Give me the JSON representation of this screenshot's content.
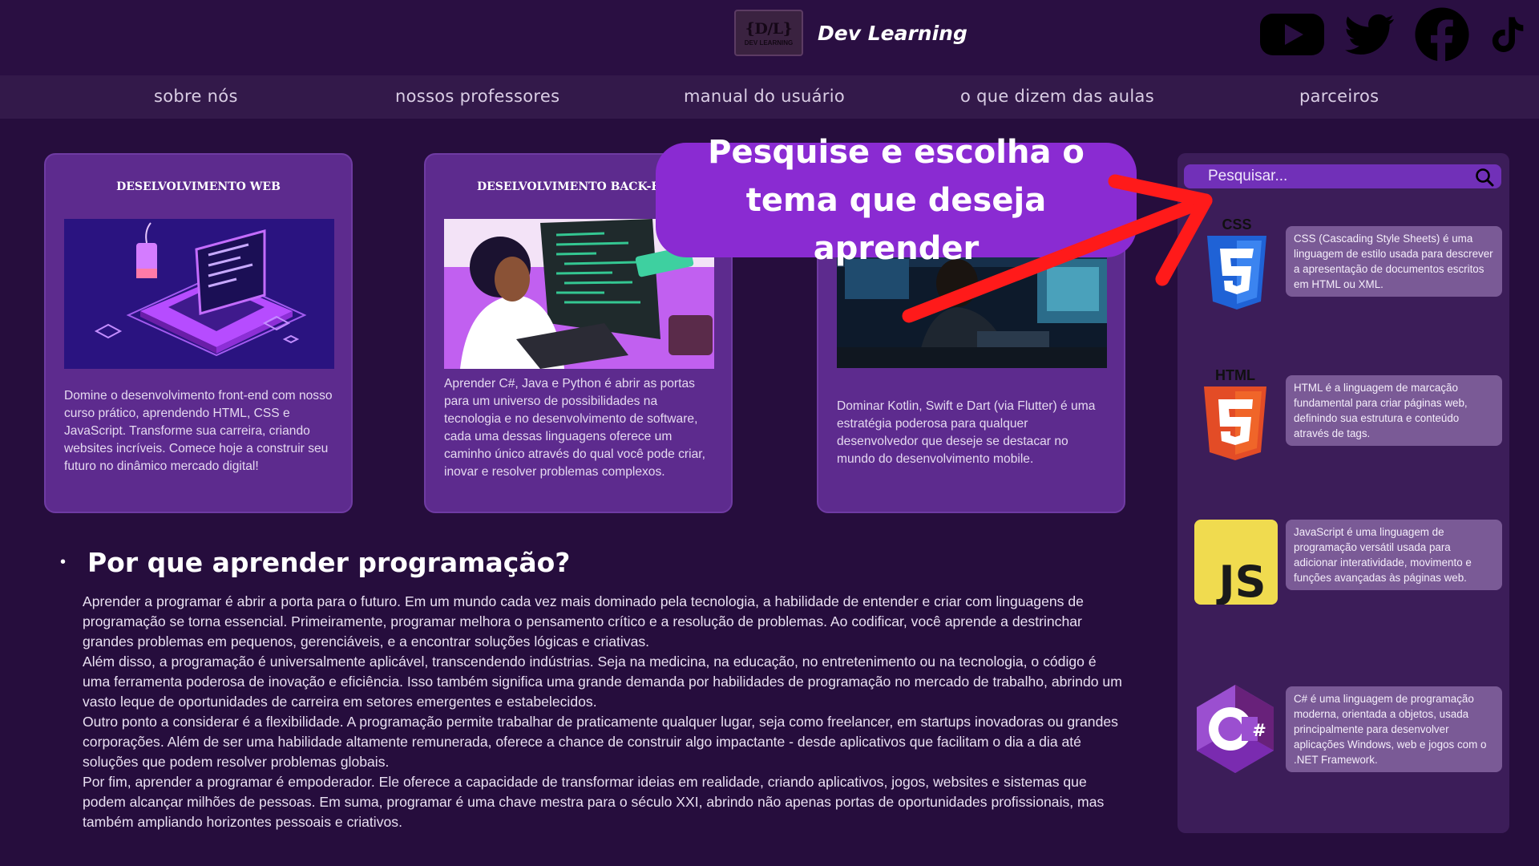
{
  "header": {
    "logo_text": "{D/L}",
    "logo_subtext": "DEV LEARNING",
    "brand_name": "Dev Learning",
    "socials": [
      "youtube-icon",
      "twitter-icon",
      "facebook-icon",
      "tiktok-icon"
    ]
  },
  "nav": {
    "items": [
      {
        "label": "sobre nós"
      },
      {
        "label": "nossos professores"
      },
      {
        "label": "manual do usuário"
      },
      {
        "label": "o que dizem das aulas"
      },
      {
        "label": "parceiros"
      }
    ]
  },
  "cards": [
    {
      "title": "DESELVOLVIMENTO WEB",
      "text": "Domine o desenvolvimento front-end com nosso curso prático, aprendendo HTML, CSS e JavaScript. Transforme sua carreira, criando websites incríveis. Comece hoje a construir seu futuro no dinâmico mercado digital!"
    },
    {
      "title": "DESELVOLVIMENTO BACK-END",
      "text": "Aprender C#, Java e Python é abrir as portas para um universo de possibilidades na tecnologia e no desenvolvimento de software, cada uma dessas linguagens oferece um caminho único através do qual você pode criar, inovar e resolver problemas complexos."
    },
    {
      "title": "",
      "text": "Dominar Kotlin, Swift e Dart (via Flutter) é uma estratégia poderosa para qualquer desenvolvedor que deseje se destacar no mundo do desenvolvimento mobile."
    }
  ],
  "article": {
    "heading": "Por que aprender programação?",
    "paragraphs": [
      "Aprender a programar é abrir a porta para o futuro. Em um mundo cada vez mais dominado pela tecnologia, a habilidade de entender e criar com linguagens de programação se torna essencial. Primeiramente, programar melhora o pensamento crítico e a resolução de problemas. Ao codificar, você aprende a destrinchar grandes problemas em pequenos, gerenciáveis, e a encontrar soluções lógicas e criativas.",
      "Além disso, a programação é universalmente aplicável, transcendendo indústrias. Seja na medicina, na educação, no entretenimento ou na tecnologia, o código é uma ferramenta poderosa de inovação e eficiência. Isso também significa uma grande demanda por habilidades de programação no mercado de trabalho, abrindo um vasto leque de oportunidades de carreira em setores emergentes e estabelecidos.",
      "Outro ponto a considerar é a flexibilidade. A programação permite trabalhar de praticamente qualquer lugar, seja como freelancer, em startups inovadoras ou grandes corporações. Além de ser uma habilidade altamente remunerada, oferece a chance de construir algo impactante - desde aplicativos que facilitam o dia a dia até soluções que podem resolver problemas globais.",
      "Por fim, aprender a programar é empoderador. Ele oferece a capacidade de transformar ideias em realidade, criando aplicativos, jogos, websites e sistemas que podem alcançar milhões de pessoas. Em suma, programar é uma chave mestra para o século XXI, abrindo não apenas portas de oportunidades profissionais, mas também ampliando horizontes pessoais e criativos."
    ]
  },
  "sidebar": {
    "search_placeholder": "Pesquisar...",
    "techs": [
      {
        "icon": "css3-icon",
        "label": "CSS",
        "text": "CSS (Cascading Style Sheets) é uma linguagem de estilo usada para descrever a apresentação de documentos escritos em HTML ou XML."
      },
      {
        "icon": "html5-icon",
        "label": "HTML",
        "text": "HTML é a linguagem de marcação fundamental para criar páginas web, definindo sua estrutura e conteúdo através de tags."
      },
      {
        "icon": "javascript-icon",
        "label": "JS",
        "text": "JavaScript é uma linguagem de programação versátil usada para adicionar interatividade, movimento e funções avançadas às páginas web."
      },
      {
        "icon": "csharp-icon",
        "label": "C#",
        "text": "C# é uma linguagem de programação moderna, orientada a objetos, usada principalmente para desenvolver aplicações Windows, web e jogos com o .NET Framework."
      }
    ]
  },
  "callout": {
    "text": "Pesquise e escolha o tema que deseja aprender"
  },
  "colors": {
    "background": "#260d3d",
    "card": "#5d2b8e",
    "callout": "#8a2bd2",
    "arrow": "#ff1a1a",
    "search": "#7130b8"
  }
}
